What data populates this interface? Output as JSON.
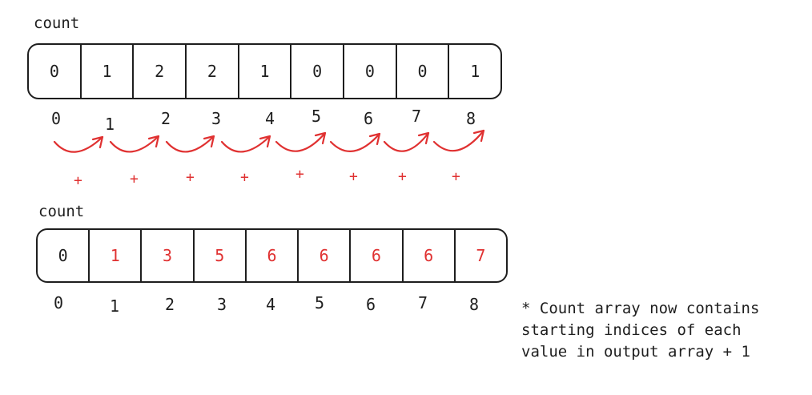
{
  "top": {
    "label": "count",
    "values": [
      "0",
      "1",
      "2",
      "2",
      "1",
      "0",
      "0",
      "0",
      "1"
    ],
    "indices": [
      "0",
      "1",
      "2",
      "3",
      "4",
      "5",
      "6",
      "7",
      "8"
    ]
  },
  "operators": [
    "+",
    "+",
    "+",
    "+",
    "+",
    "+",
    "+",
    "+"
  ],
  "bottom": {
    "label": "count",
    "values": [
      "0",
      "1",
      "3",
      "5",
      "6",
      "6",
      "6",
      "6",
      "7"
    ],
    "indices": [
      "0",
      "1",
      "2",
      "3",
      "4",
      "5",
      "6",
      "7",
      "8"
    ]
  },
  "note": {
    "line1": "* Count array now contains",
    "line2": "starting indices of each",
    "line3": "value in output array + 1"
  },
  "colors": {
    "ink": "#1e1e1e",
    "accent": "#e03131"
  }
}
